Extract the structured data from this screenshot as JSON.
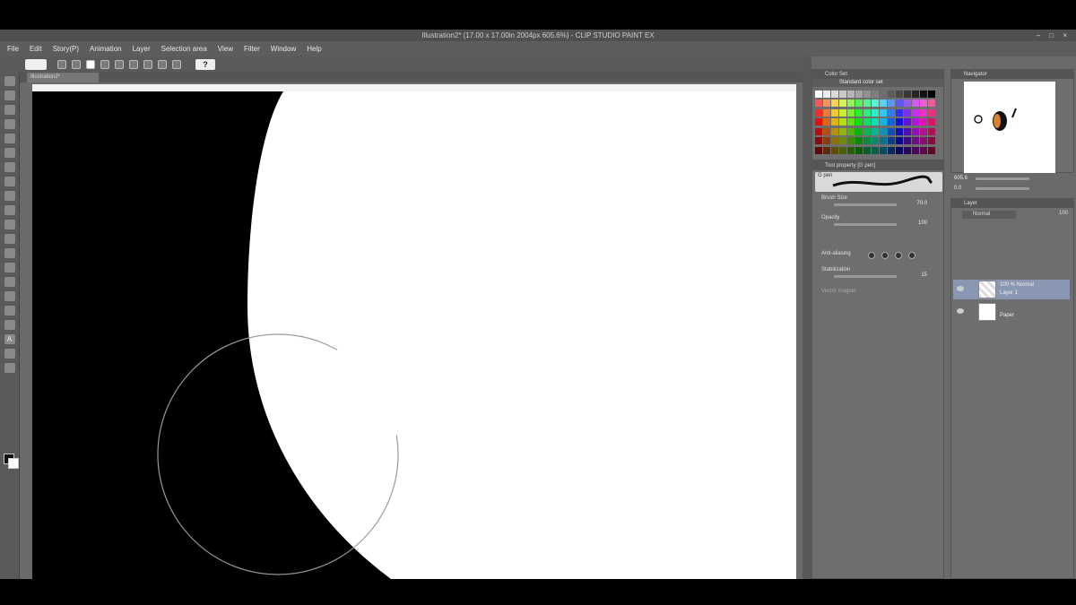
{
  "window": {
    "title": "Illustration2* (17.00 x 17.00in 2004px 605.6%) - CLIP STUDIO PAINT EX",
    "controls": "– □ ×"
  },
  "menu": [
    "File",
    "Edit",
    "Story(P)",
    "Animation",
    "Layer",
    "Selection area",
    "View",
    "Filter",
    "Window",
    "Help"
  ],
  "document": {
    "tab_label": "Illustration2*"
  },
  "toolbar": {
    "tool_icons": [
      "zoom",
      "hand",
      "rotate",
      "move",
      "select",
      "lasso",
      "eyedropper",
      "pen",
      "pencil",
      "brush",
      "airbrush",
      "decoration",
      "eraser",
      "fill",
      "gradient",
      "figure",
      "frame",
      "ruler",
      "text",
      "balloon",
      "correction"
    ]
  },
  "colorset": {
    "tab_label": "Color Set",
    "set_name": "Standard color set",
    "colors": [
      "#ffffff",
      "#f0f0f0",
      "#d8d8d8",
      "#c0c0c0",
      "#a8a8a8",
      "#909090",
      "#787878",
      "#606060",
      "#484848",
      "#303030",
      "#181818",
      "#000000",
      "#ff0000",
      "#00ff00",
      "#0000ff"
    ]
  },
  "tool_property": {
    "tab_label": "Tool property [G pen]",
    "brush_name": "G pen",
    "brush_size_label": "Brush Size",
    "brush_size_value": "70.0",
    "opacity_label": "Opacity",
    "opacity_value": "100",
    "antialiasing_label": "Anti-aliasing",
    "stabilization_label": "Stabilization",
    "stabilization_value": "15",
    "vector_magnet_label": "Vector magnet"
  },
  "navigator": {
    "tab_label": "Navigator",
    "zoom": "605.6",
    "angle": "0.0"
  },
  "layers": {
    "tab_label": "Layer",
    "blend_mode": "Normal",
    "opacity": "100",
    "items": [
      {
        "opacity_mode": "100 % Normal",
        "name": "Layer 1",
        "selected": true
      },
      {
        "opacity_mode": "",
        "name": "Paper",
        "selected": false
      }
    ]
  },
  "accent": "#8a97b2"
}
